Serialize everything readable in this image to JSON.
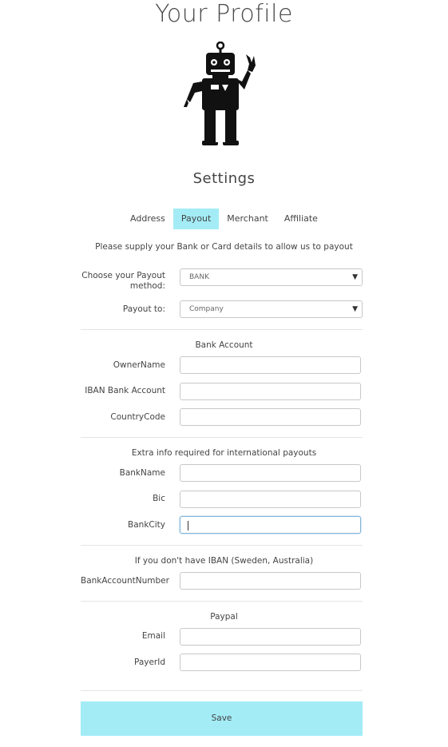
{
  "page": {
    "title": "Your Profile"
  },
  "settings": {
    "title": "Settings"
  },
  "tabs": [
    "Address",
    "Payout",
    "Merchant",
    "Affiliate"
  ],
  "active_tab": "Payout",
  "intro": "Please supply your Bank or Card details to allow us to payout",
  "payout": {
    "method_label": "Choose your Payout method:",
    "method_value": "BANK",
    "to_label": "Payout to:",
    "to_value": "Company"
  },
  "bank_account": {
    "heading": "Bank Account",
    "owner_label": "OwnerName",
    "iban_label": "IBAN Bank Account",
    "country_label": "CountryCode"
  },
  "international": {
    "heading": "Extra info required for international payouts",
    "bankname_label": "BankName",
    "bic_label": "Bic",
    "bankcity_label": "BankCity"
  },
  "no_iban": {
    "heading": "If you don't have IBAN (Sweden, Australia)",
    "account_label": "BankAccountNumber"
  },
  "paypal": {
    "heading": "Paypal",
    "email_label": "Email",
    "payerid_label": "PayerId"
  },
  "save_label": "Save",
  "colors": {
    "accent": "#a3ecf6",
    "robot": "#111111"
  },
  "icons": {
    "robot": "robot-icon",
    "dropdown": "chevron-down-icon"
  }
}
